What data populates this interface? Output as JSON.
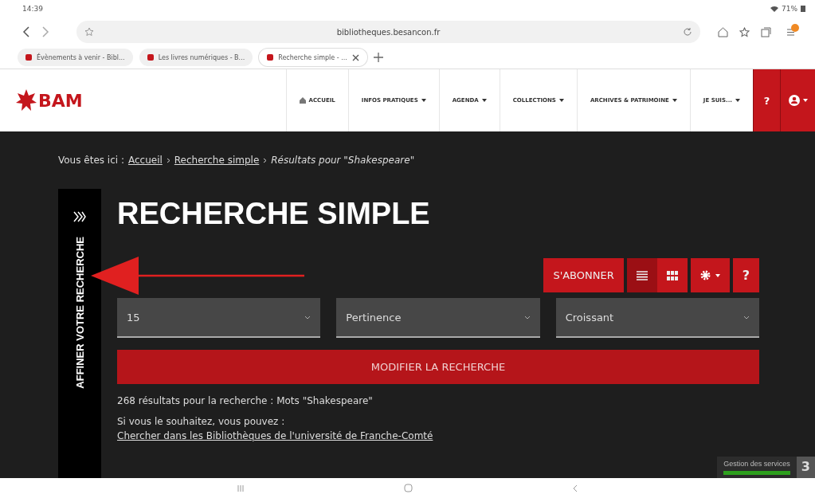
{
  "status_bar": {
    "time": "14:39",
    "battery": "71%"
  },
  "browser": {
    "url": "bibliotheques.besancon.fr",
    "tabs": [
      {
        "label": "Évènements à venir - Bibl...",
        "selected": false
      },
      {
        "label": "Les livres numériques - B...",
        "selected": false
      },
      {
        "label": "Recherche simple - ...",
        "selected": true
      }
    ]
  },
  "site_header": {
    "logo": "BAM",
    "nav": [
      {
        "label": "ACCUEIL",
        "kind": "home"
      },
      {
        "label": "INFOS PRATIQUES",
        "kind": "dropdown"
      },
      {
        "label": "AGENDA",
        "kind": "dropdown"
      },
      {
        "label": "COLLECTIONS",
        "kind": "dropdown"
      },
      {
        "label": "ARCHIVES & PATRIMOINE",
        "kind": "dropdown"
      },
      {
        "label": "JE SUIS...",
        "kind": "dropdown"
      }
    ],
    "help": "?"
  },
  "breadcrumb": {
    "prefix": "Vous êtes ici :",
    "links": [
      "Accueil",
      "Recherche simple"
    ],
    "current": "Résultats pour \"Shakespeare\""
  },
  "sidebar_toggle": {
    "label": "AFFINER VOTRE RECHERCHE"
  },
  "title": "RECHERCHE SIMPLE",
  "toolbar": {
    "subscribe": "S'ABONNER",
    "views": [
      {
        "kind": "list",
        "selected": true
      },
      {
        "kind": "grid",
        "selected": false
      }
    ],
    "help": "?"
  },
  "selects": [
    {
      "value": "15"
    },
    {
      "value": "Pertinence"
    },
    {
      "value": "Croissant"
    }
  ],
  "modify_button": "MODIFIER LA RECHERCHE",
  "results_text": "268 résultats pour la recherche : Mots \"Shakespeare\"",
  "suggestion": "Si vous le souhaitez, vous pouvez :",
  "suggestion_link": "Chercher dans les Bibliothèques de l'université de Franche-Comté",
  "cookie_widget": {
    "label": "Gestion des services",
    "count": "3"
  }
}
